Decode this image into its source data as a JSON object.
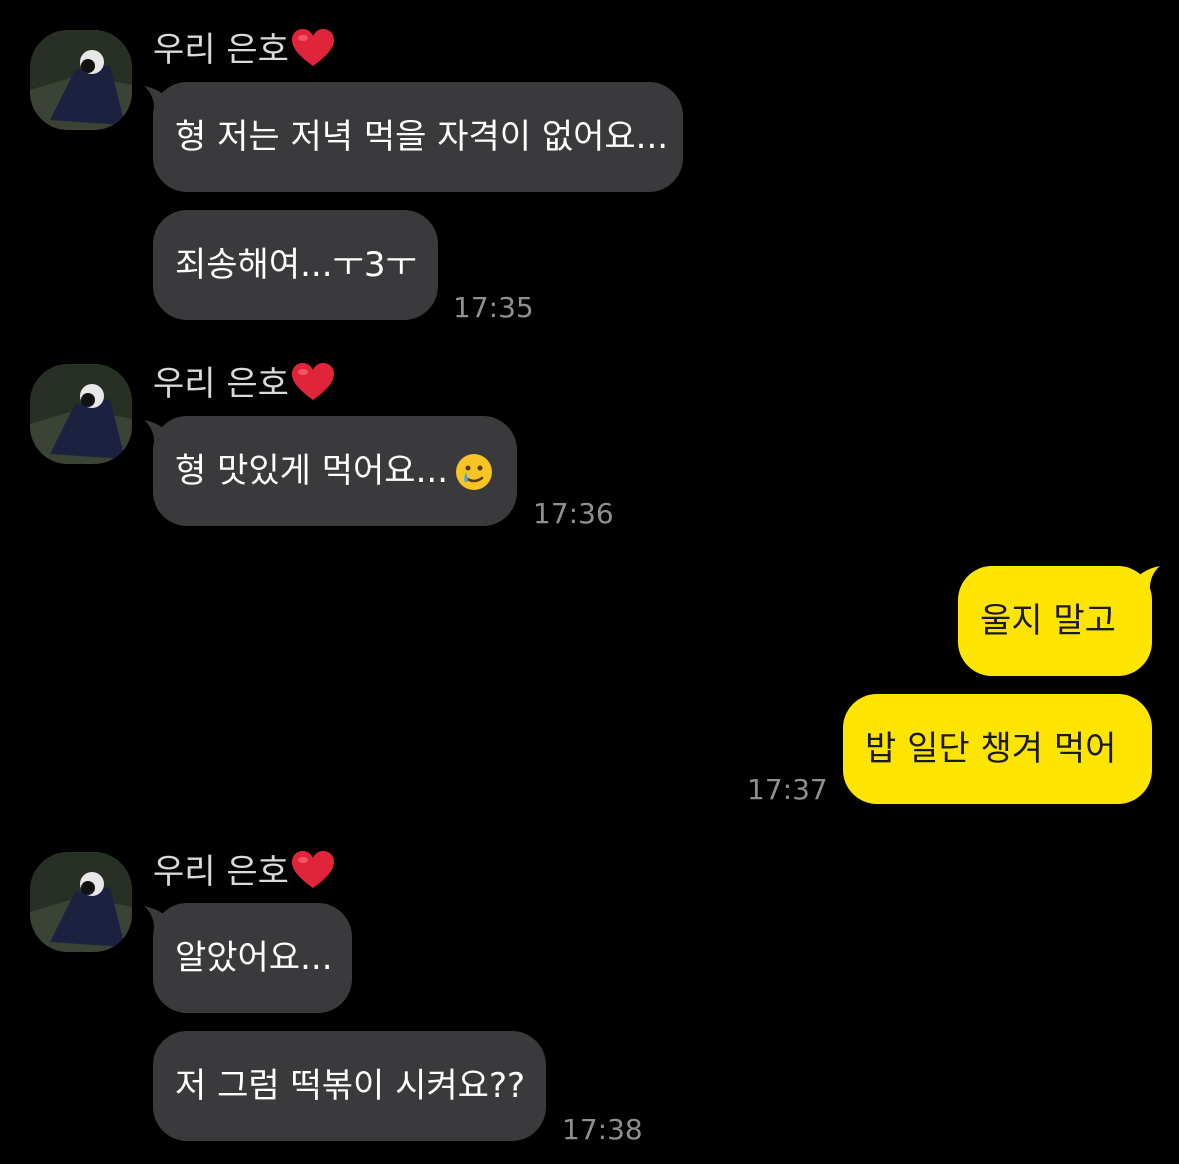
{
  "colors": {
    "background": "#000000",
    "incoming_bubble": "#3a3a3c",
    "outgoing_bubble": "#fee500",
    "timestamp": "#8e8e93",
    "sender_name": "#d9d9d9"
  },
  "groups": [
    {
      "sender": "우리 은호",
      "sender_icon": "red-heart-icon",
      "messages": [
        "형 저는 저녁 먹을 자격이 없어요...",
        "죄송해여...ㅜ3ㅜ"
      ],
      "time": "17:35"
    },
    {
      "sender": "우리 은호",
      "sender_icon": "red-heart-icon",
      "messages": [
        "형 맛있게 먹어요..."
      ],
      "message_icon": "smiling-face-with-tear-icon",
      "time": "17:36"
    },
    {
      "outgoing": true,
      "messages": [
        "울지 말고",
        "밥 일단 챙겨 먹어"
      ],
      "time": "17:37"
    },
    {
      "sender": "우리 은호",
      "sender_icon": "red-heart-icon",
      "messages": [
        "알았어요...",
        "저 그럼 떡볶이 시켜요??"
      ],
      "time": "17:38"
    }
  ]
}
